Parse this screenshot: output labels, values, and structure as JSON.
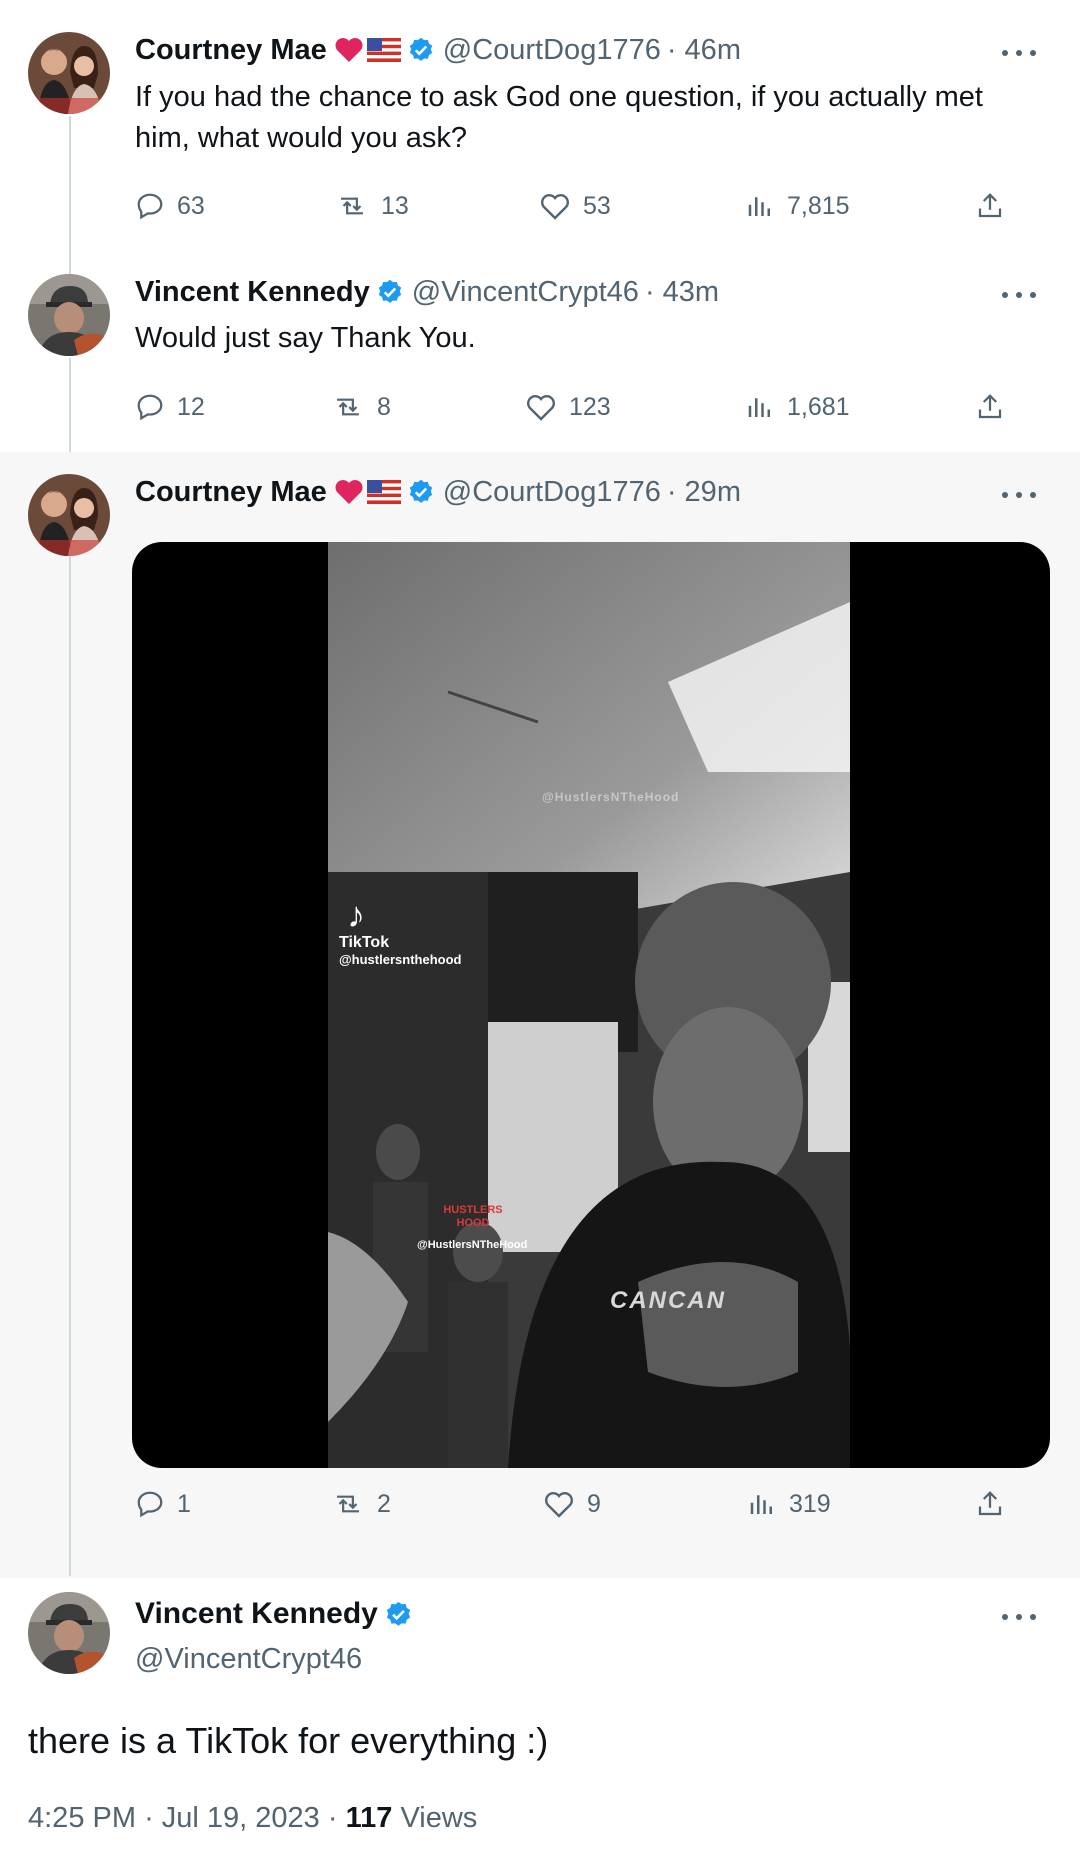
{
  "tweets": [
    {
      "name": "Courtney Mae",
      "handle": "@CourtDog1776",
      "time": "· 46m",
      "text": "If you had the chance to ask God one question, if you actually met him, what would you ask?",
      "replies": "63",
      "retweets": "13",
      "likes": "53",
      "views": "7,815"
    },
    {
      "name": "Vincent Kennedy",
      "handle": "@VincentCrypt46",
      "time": "· 43m",
      "text": "Would just say Thank You.",
      "replies": "12",
      "retweets": "8",
      "likes": "123",
      "views": "1,681"
    },
    {
      "name": "Courtney Mae",
      "handle": "@CourtDog1776",
      "time": "· 29m",
      "replies": "1",
      "retweets": "2",
      "likes": "9",
      "views": "319",
      "video": {
        "watermark_top": "@HustlersNTheHood",
        "tiktok_label": "TikTok",
        "tiktok_handle": "@hustlersnthehood",
        "logo_text": "HUSTLERS HOOD",
        "watermark_bottom": "@HustlersNTheHood",
        "shirt_text": "CANCAN"
      }
    }
  ],
  "main_tweet": {
    "name": "Vincent Kennedy",
    "handle": "@VincentCrypt46",
    "text": "there is a TikTok for everything :)",
    "time": "4:25 PM",
    "date": "Jul 19, 2023",
    "views_count": "117",
    "views_label": "Views"
  },
  "icons": {
    "reply": "reply-icon",
    "retweet": "retweet-icon",
    "like": "heart-icon",
    "views": "views-icon",
    "share": "share-icon",
    "more": "more-icon",
    "verified": "verified-badge-icon"
  },
  "colors": {
    "verified_blue": "#1d9bf0",
    "heart_red": "#e0245e",
    "secondary_text": "#536471",
    "thread_line": "#cfd9de"
  }
}
